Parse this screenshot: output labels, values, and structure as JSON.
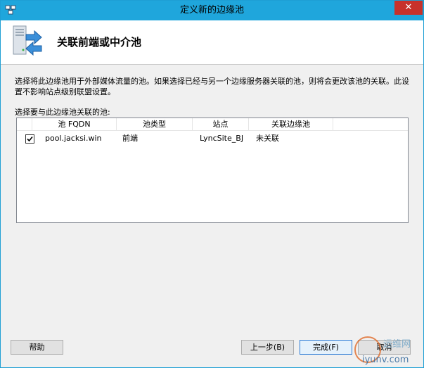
{
  "window": {
    "title": "定义新的边缘池",
    "close_glyph": "✕"
  },
  "header": {
    "title": "关联前端或中介池"
  },
  "body": {
    "description": "选择将此边缘池用于外部媒体流量的池。如果选择已经与另一个边缘服务器关联的池，则将会更改该池的关联。此设置不影响站点级别联盟设置。",
    "select_label": "选择要与此边缘池关联的池:"
  },
  "table": {
    "columns": [
      "池 FQDN",
      "池类型",
      "站点",
      "关联边缘池"
    ],
    "rows": [
      {
        "checked": true,
        "fqdn": "pool.jacksi.win",
        "type": "前端",
        "site": "LyncSite_BJ",
        "associated": "未关联"
      }
    ]
  },
  "buttons": {
    "help": "帮助",
    "back": "上一步(B)",
    "finish": "完成(F)",
    "cancel": "取消"
  },
  "watermark": {
    "line1": "运维网",
    "line2": "iyunv.com"
  },
  "colors": {
    "titlebar": "#1fa6dc",
    "close": "#c7322b",
    "panel": "#f0f0f0"
  }
}
